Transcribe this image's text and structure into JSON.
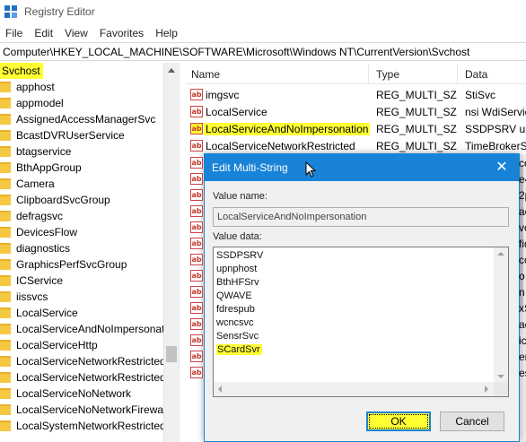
{
  "window": {
    "title": "Registry Editor"
  },
  "menu": [
    "File",
    "Edit",
    "View",
    "Favorites",
    "Help"
  ],
  "address": "Computer\\HKEY_LOCAL_MACHINE\\SOFTWARE\\Microsoft\\Windows NT\\CurrentVersion\\Svchost",
  "tree": {
    "selected": "Svchost",
    "items": [
      "apphost",
      "appmodel",
      "AssignedAccessManagerSvc",
      "BcastDVRUserService",
      "btagservice",
      "BthAppGroup",
      "Camera",
      "ClipboardSvcGroup",
      "defragsvc",
      "DevicesFlow",
      "diagnostics",
      "GraphicsPerfSvcGroup",
      "ICService",
      "iissvcs",
      "LocalService",
      "LocalServiceAndNoImpersonat",
      "LocalServiceHttp",
      "LocalServiceNetworkRestricted",
      "LocalServiceNetworkRestrictedI",
      "LocalServiceNoNetwork",
      "LocalServiceNoNetworkFirewal",
      "LocalSystemNetworkRestricted"
    ]
  },
  "list": {
    "headers": {
      "name": "Name",
      "type": "Type",
      "data": "Data"
    },
    "icon_text": "ab",
    "rows": [
      {
        "name": "imgsvc",
        "type": "REG_MULTI_SZ",
        "data": "StiSvc"
      },
      {
        "name": "LocalService",
        "type": "REG_MULTI_SZ",
        "data": "nsi WdiServic"
      },
      {
        "name": "LocalServiceAndNoImpersonation",
        "type": "REG_MULTI_SZ",
        "data": "SSDPSRV upn"
      },
      {
        "name": "LocalServiceNetworkRestricted",
        "type": "REG_MULTI_SZ",
        "data": "TimeBrokerSv"
      }
    ],
    "right_partial": [
      "co",
      "e4",
      "2p",
      "ac",
      "vc",
      "fid",
      "co",
      "o",
      "n",
      "xS",
      "ac",
      "ic",
      "er",
      "es"
    ]
  },
  "dialog": {
    "title": "Edit Multi-String",
    "close_glyph": "✕",
    "value_name_label": "Value name:",
    "value_name": "LocalServiceAndNoImpersonation",
    "value_data_label": "Value data:",
    "value_data": [
      "SSDPSRV",
      "upnphost",
      "BthHFSrv",
      "QWAVE",
      "fdrespub",
      "wcncsvc",
      "SensrSvc",
      "SCardSvr"
    ],
    "ok_label": "OK",
    "cancel_label": "Cancel"
  },
  "colors": {
    "highlight": "#ffff33",
    "accent": "#1883d7"
  }
}
